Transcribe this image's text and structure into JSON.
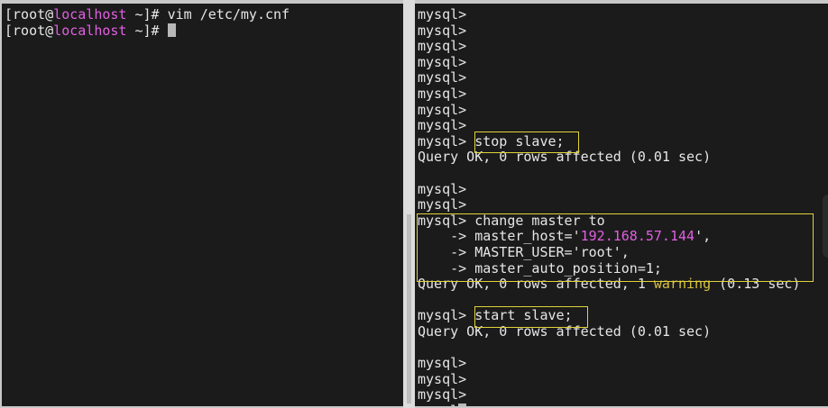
{
  "left_terminal": {
    "lines": [
      {
        "user": "[root@",
        "host": "localhost",
        "path": " ~]# ",
        "cmd": "vim /etc/my.cnf"
      },
      {
        "user": "[root@",
        "host": "localhost",
        "path": " ~]# ",
        "cmd": ""
      }
    ]
  },
  "right_terminal": {
    "prompt": "mysql>",
    "stop_cmd": "stop slave;",
    "stop_result": "Query OK, 0 rows affected (0.01 sec)",
    "change_cmd": "change master to",
    "cont_prefix": "    -> ",
    "host_key": "master_host='",
    "host_ip": "192.168.57.144",
    "host_end": "',",
    "user_line": "MASTER_USER='root',",
    "autopos_line": "master_auto_position=1;",
    "change_result_a": "Query OK, 0 rows affected, 1 ",
    "warning_word": "warning",
    "change_result_b": " (0.13 sec)",
    "start_cmd": "start slave;",
    "start_result": "Query OK, 0 rows affected (0.01 sec)",
    "partial_prompt": "mysql"
  },
  "colors": {
    "background": "#1b1b1b",
    "text": "#e6e6e6",
    "hostname": "#e060e0",
    "ip": "#e060e0",
    "warning": "#d8c040",
    "highlight_box": "#e0d23a"
  }
}
